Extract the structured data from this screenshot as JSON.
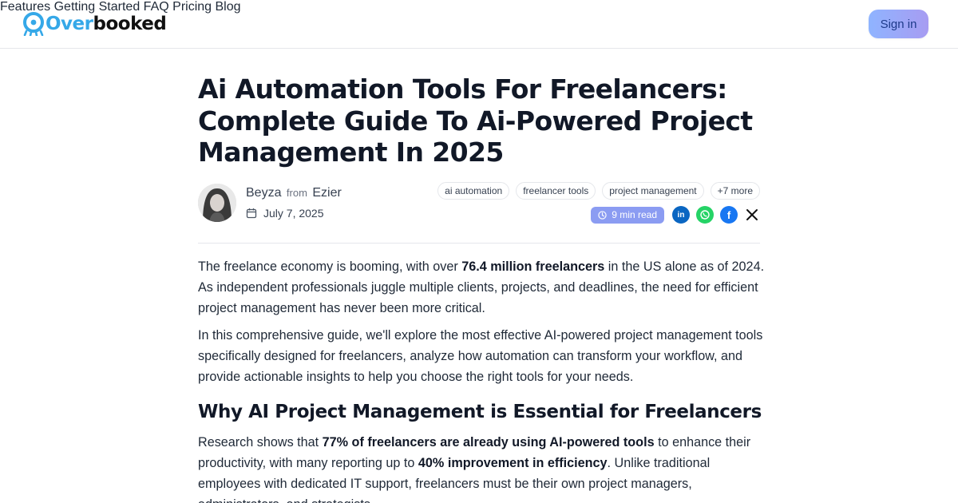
{
  "header": {
    "logo": {
      "part1": "Over",
      "part2": "booked"
    },
    "nav": [
      {
        "label": "Features"
      },
      {
        "label": "Getting Started"
      },
      {
        "label": "FAQ"
      },
      {
        "label": "Pricing"
      },
      {
        "label": "Blog"
      }
    ],
    "signin_label": "Sign in"
  },
  "article": {
    "title": "Ai Automation Tools For Freelancers: Complete Guide To Ai-Powered Project Management In 2025",
    "author": {
      "name": "Beyza",
      "from": "from",
      "org": "Ezier"
    },
    "date": "July 7, 2025",
    "tags": [
      "ai automation",
      "freelancer tools",
      "project management",
      "+7 more"
    ],
    "read_time": "9 min read",
    "share_icons": [
      "linkedin-icon",
      "whatsapp-icon",
      "facebook-icon",
      "x-icon"
    ],
    "p1": {
      "t1": "The freelance economy is booming, with over ",
      "b1": "76.4 million freelancers",
      "t2": " in the US alone as of 2024. As independent professionals juggle multiple clients, projects, and deadlines, the need for efficient project management has never been more critical."
    },
    "p2": "In this comprehensive guide, we'll explore the most effective AI-powered project management tools specifically designed for freelancers, analyze how automation can transform your workflow, and provide actionable insights to help you choose the right tools for your needs.",
    "h2": "Why AI Project Management is Essential for Freelancers",
    "p3": {
      "t1": "Research shows that ",
      "b1": "77% of freelancers are already using AI-powered tools",
      "t2": " to enhance their productivity, with many reporting up to ",
      "b2": "40% improvement in efficiency",
      "t3": ". Unlike traditional employees with dedicated IT support, freelancers must be their own project managers, administrators, and strategists."
    }
  },
  "colors": {
    "logo_blue": "#35a8e8",
    "signin_gradient_start": "#8fb4ff",
    "signin_gradient_end": "#a79cf2",
    "read_time_bg": "#8b9cf2",
    "linkedin": "#0a66c2",
    "whatsapp": "#25d366",
    "facebook": "#1877f2"
  }
}
